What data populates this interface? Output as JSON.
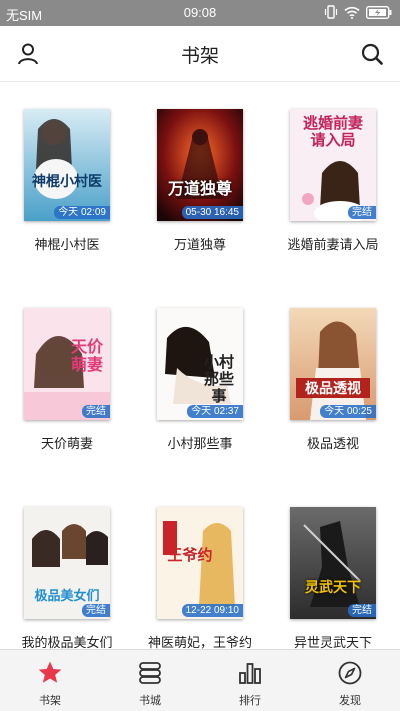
{
  "status_bar": {
    "carrier": "无SIM",
    "time": "09:08"
  },
  "header": {
    "title": "书架"
  },
  "books": [
    {
      "title": "神棍小村医",
      "badge": "今天 02:09",
      "cover_text": "神棍小村医",
      "cover_theme": "teal"
    },
    {
      "title": "万道独尊",
      "badge": "05-30 16:45",
      "cover_text": "万道独尊",
      "cover_theme": "dark-red"
    },
    {
      "title": "逃婚前妻请入局",
      "badge": "完结",
      "cover_text": "逃婚前妻请入局",
      "cover_theme": "pink-light"
    },
    {
      "title": "天价萌妻",
      "badge": "完结",
      "cover_text": "天价萌妻",
      "cover_theme": "pink"
    },
    {
      "title": "小村那些事",
      "badge": "今天 02:37",
      "cover_text": "小村那些事",
      "cover_theme": "white"
    },
    {
      "title": "极品透视",
      "badge": "今天 00:25",
      "cover_text": "极品透视",
      "cover_theme": "warm"
    },
    {
      "title": "我的极品美女们",
      "badge": "完结",
      "cover_text": "极品美女们",
      "cover_theme": "light"
    },
    {
      "title": "神医萌妃，王爷约",
      "badge": "12-22 09:10",
      "cover_text": "王爷约",
      "cover_theme": "gold"
    },
    {
      "title": "异世灵武天下",
      "badge": "完结",
      "cover_text": "灵武天下",
      "cover_theme": "grey"
    }
  ],
  "tabs": [
    {
      "label": "书架",
      "icon": "star-icon",
      "active": true
    },
    {
      "label": "书城",
      "icon": "stack-icon",
      "active": false
    },
    {
      "label": "排行",
      "icon": "bar-chart-icon",
      "active": false
    },
    {
      "label": "发现",
      "icon": "compass-icon",
      "active": false
    }
  ],
  "colors": {
    "accent": "#e8384a",
    "badge": "#286ec8",
    "status_bar": "#8a8a8a"
  }
}
